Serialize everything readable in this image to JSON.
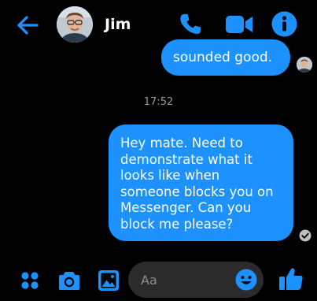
{
  "theme": {
    "accent": "#1d92ff",
    "background": "#000000",
    "bubble_text": "#ffffff",
    "meta_text": "#9a9a9a",
    "input_background": "#2b2b2b"
  },
  "header": {
    "back_icon": "arrow-left-icon",
    "contact_name": "Jim",
    "actions": [
      "phone-icon",
      "video-camera-icon",
      "info-icon"
    ]
  },
  "messages": {
    "previous_partial": "sounded good.",
    "timestamp": "17:52",
    "sent_text": "Hey mate. Need to demonstrate what it looks like when someone blocks you on Messenger. Can you block me please?",
    "status_icon": "read-check-icon"
  },
  "composer": {
    "icons": [
      "menu-dots-icon",
      "camera-icon",
      "gallery-icon",
      "emoji-icon",
      "thumbs-up-icon"
    ],
    "placeholder": "Aa",
    "value": ""
  }
}
